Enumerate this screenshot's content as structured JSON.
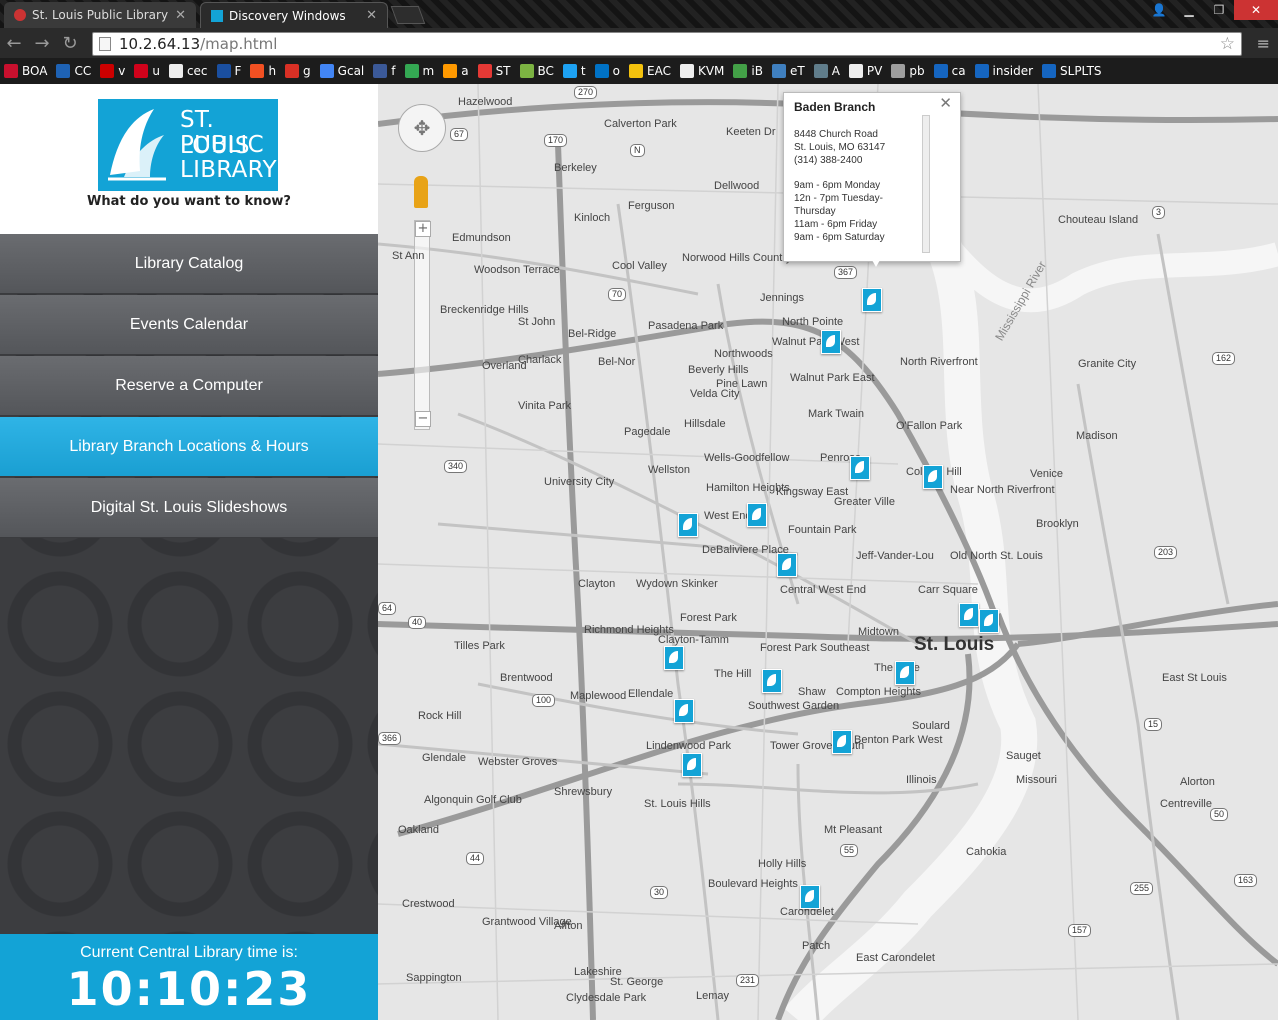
{
  "browser": {
    "tabs": [
      {
        "label": "St. Louis Public Library",
        "active": false
      },
      {
        "label": "Discovery Windows",
        "active": true
      }
    ],
    "url_host": "10.2.64.13",
    "url_path": "/map.html",
    "bookmarks": [
      {
        "label": "BOA",
        "color": "#c8102e"
      },
      {
        "label": "CC",
        "color": "#1e62b4"
      },
      {
        "label": "v",
        "color": "#cc0000"
      },
      {
        "label": "u",
        "color": "#d0021b"
      },
      {
        "label": "cec",
        "color": "#eeeeee"
      },
      {
        "label": "F",
        "color": "#1a4fa0"
      },
      {
        "label": "h",
        "color": "#f25022"
      },
      {
        "label": "g",
        "color": "#d93025"
      },
      {
        "label": "Gcal",
        "color": "#4285f4"
      },
      {
        "label": "f",
        "color": "#3b5998"
      },
      {
        "label": "m",
        "color": "#34a853"
      },
      {
        "label": "a",
        "color": "#ff9900"
      },
      {
        "label": "ST",
        "color": "#e53935"
      },
      {
        "label": "BC",
        "color": "#7cb342"
      },
      {
        "label": "t",
        "color": "#1da1f2"
      },
      {
        "label": "o",
        "color": "#0072c6"
      },
      {
        "label": "EAC",
        "color": "#f4c20d"
      },
      {
        "label": "KVM",
        "color": "#eeeeee"
      },
      {
        "label": "iB",
        "color": "#43a047"
      },
      {
        "label": "eT",
        "color": "#3f7fbf"
      },
      {
        "label": "A",
        "color": "#607d8b"
      },
      {
        "label": "PV",
        "color": "#eeeeee"
      },
      {
        "label": "pb",
        "color": "#9e9e9e"
      },
      {
        "label": "ca",
        "color": "#1565c0"
      },
      {
        "label": "insider",
        "color": "#1565c0"
      },
      {
        "label": "SLPLTS",
        "color": "#1565c0"
      }
    ]
  },
  "logo": {
    "line1": "ST. LOUIS",
    "line2": "PUBLIC",
    "line3": "LIBRARY",
    "tagline": "What do you want to know?"
  },
  "nav": [
    {
      "label": "Library Catalog",
      "active": false
    },
    {
      "label": "Events Calendar",
      "active": false
    },
    {
      "label": "Reserve a Computer",
      "active": false
    },
    {
      "label": "Library Branch Locations & Hours",
      "active": true
    },
    {
      "label": "Digital St. Louis Slideshows",
      "active": false
    }
  ],
  "clock": {
    "label": "Current Central Library time is:",
    "time": "10:10:23"
  },
  "popup": {
    "title": "Baden Branch",
    "address1": "8448 Church Road",
    "address2": "St. Louis, MO 63147",
    "phone": "(314) 388-2400",
    "hours": [
      "9am - 6pm Monday",
      "12n - 7pm Tuesday-",
      "Thursday",
      "11am - 6pm Friday",
      "9am - 6pm Saturday"
    ]
  },
  "map_labels": [
    "Hazelwood",
    "Calverton Park",
    "Keeten Dr",
    "Berkeley",
    "Kinloch",
    "Ferguson",
    "Dellwood",
    "Edmundson",
    "St Ann",
    "Woodson Terrace",
    "Cool Valley",
    "Norwood Hills Country Club",
    "Jennings",
    "North Pointe",
    "Walnut Park West",
    "Walnut Park East",
    "North Riverfront",
    "Breckenridge Hills",
    "St John",
    "Bel-Ridge",
    "Pasadena Park",
    "Northwoods",
    "Charlack",
    "Bel-Nor",
    "Beverly Hills",
    "Pine Lawn",
    "Overland",
    "Velda City",
    "Vinita Park",
    "Hillsdale",
    "Mark Twain",
    "O'Fallon Park",
    "Pagedale",
    "Wellston",
    "Wells-Goodfellow",
    "Penrose",
    "College Hill",
    "Near North Riverfront",
    "University City",
    "Hamilton Heights",
    "Kingsway East",
    "Greater Ville",
    "West End",
    "Fountain Park",
    "DeBaliviere Place",
    "Jeff-Vander-Lou",
    "Old North St. Louis",
    "Clayton",
    "Wydown Skinker",
    "Central West End",
    "Carr Square",
    "Forest Park",
    "Richmond Heights",
    "Clayton-Tamm",
    "Midtown",
    "St. Louis",
    "Forest Park Southeast",
    "Tilles Park",
    "Brentwood",
    "The Hill",
    "Shaw",
    "Compton Heights",
    "The Gate",
    "Maplewood",
    "Ellendale",
    "Southwest Garden",
    "Rock Hill",
    "Soulard",
    "Lindenwood Park",
    "Tower Grove South",
    "Benton Park West",
    "Glendale",
    "Webster Groves",
    "Shrewsbury",
    "Algonquin Golf Club",
    "St. Louis Hills",
    "Mt Pleasant",
    "Oakland",
    "Holly Hills",
    "Boulevard Heights",
    "Carondelet",
    "Crestwood",
    "Grantwood Village",
    "Affton",
    "Lakeshire",
    "St. George",
    "Clydesdale Park",
    "Patch",
    "East Carondelet",
    "Lemay",
    "Chouteau Island",
    "Granite City",
    "Madison",
    "Venice",
    "Brooklyn",
    "East St Louis",
    "Alorton",
    "Centreville",
    "Cahokia",
    "Sauget",
    "Sappington",
    "Mississippi River",
    "Illinois",
    "Missouri"
  ],
  "highways": [
    "270",
    "67",
    "170",
    "N",
    "367",
    "70",
    "340",
    "64",
    "40",
    "100",
    "366",
    "44",
    "55",
    "30",
    "231",
    "203",
    "3",
    "162",
    "15",
    "50",
    "157",
    "255",
    "163"
  ]
}
